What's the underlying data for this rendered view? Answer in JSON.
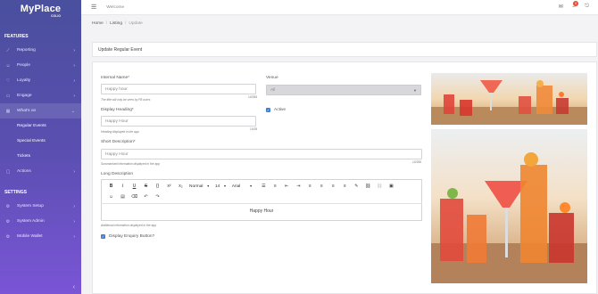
{
  "app": {
    "brand": "MyPlace",
    "brand_sub": "COLIO"
  },
  "sidebar": {
    "features_title": "FEATURES",
    "settings_title": "SETTINGS",
    "items": [
      {
        "label": "Reporting",
        "icon": "chart-icon"
      },
      {
        "label": "People",
        "icon": "people-icon"
      },
      {
        "label": "Loyalty",
        "icon": "heart-icon"
      },
      {
        "label": "Engage",
        "icon": "chat-icon"
      },
      {
        "label": "What's on",
        "icon": "calendar-icon"
      },
      {
        "label": "Actions",
        "icon": "actions-icon"
      }
    ],
    "subitems": [
      "Regular Events",
      "Special Events",
      "Tickets"
    ],
    "settings_items": [
      {
        "label": "System Setup",
        "icon": "gear-icon"
      },
      {
        "label": "System Admin",
        "icon": "gear-icon"
      },
      {
        "label": "Mobile Wallet",
        "icon": "gear-icon"
      }
    ]
  },
  "header": {
    "welcome": "Welcome",
    "notification_count": "0"
  },
  "breadcrumb": {
    "home": "Home",
    "listing": "Listing",
    "current": "Update"
  },
  "page": {
    "title": "Update Regular Event"
  },
  "form": {
    "internal_name": {
      "label": "Internal Name*",
      "placeholder": "Happy hour",
      "hint": "The title will only be seen by FB users",
      "count": "10/255"
    },
    "display_heading": {
      "label": "Display Heading*",
      "placeholder": "Happy Hour",
      "hint": "Heading displayed in the app",
      "count": "10/25"
    },
    "short_description": {
      "label": "Short Description*",
      "placeholder": "Happy Hour",
      "hint": "Summarised information displayed in the app",
      "count": "10/255"
    },
    "long_description": {
      "label": "Long Description",
      "content": "Happy Hour",
      "hint": "Additional information displayed in the app",
      "font_size": "14",
      "font_family": "Arial",
      "paragraph": "Normal"
    },
    "venue": {
      "label": "Venue",
      "value": "All"
    },
    "active": {
      "label": "Active",
      "checked": true
    },
    "enquiry": {
      "label": "Display Enquiry Button?",
      "checked": true
    }
  },
  "colors": {
    "sidebar_top": "#4a4f9e",
    "sidebar_bottom": "#7a55d6",
    "checkbox": "#3f7fd6",
    "badge": "#e74c3c"
  }
}
